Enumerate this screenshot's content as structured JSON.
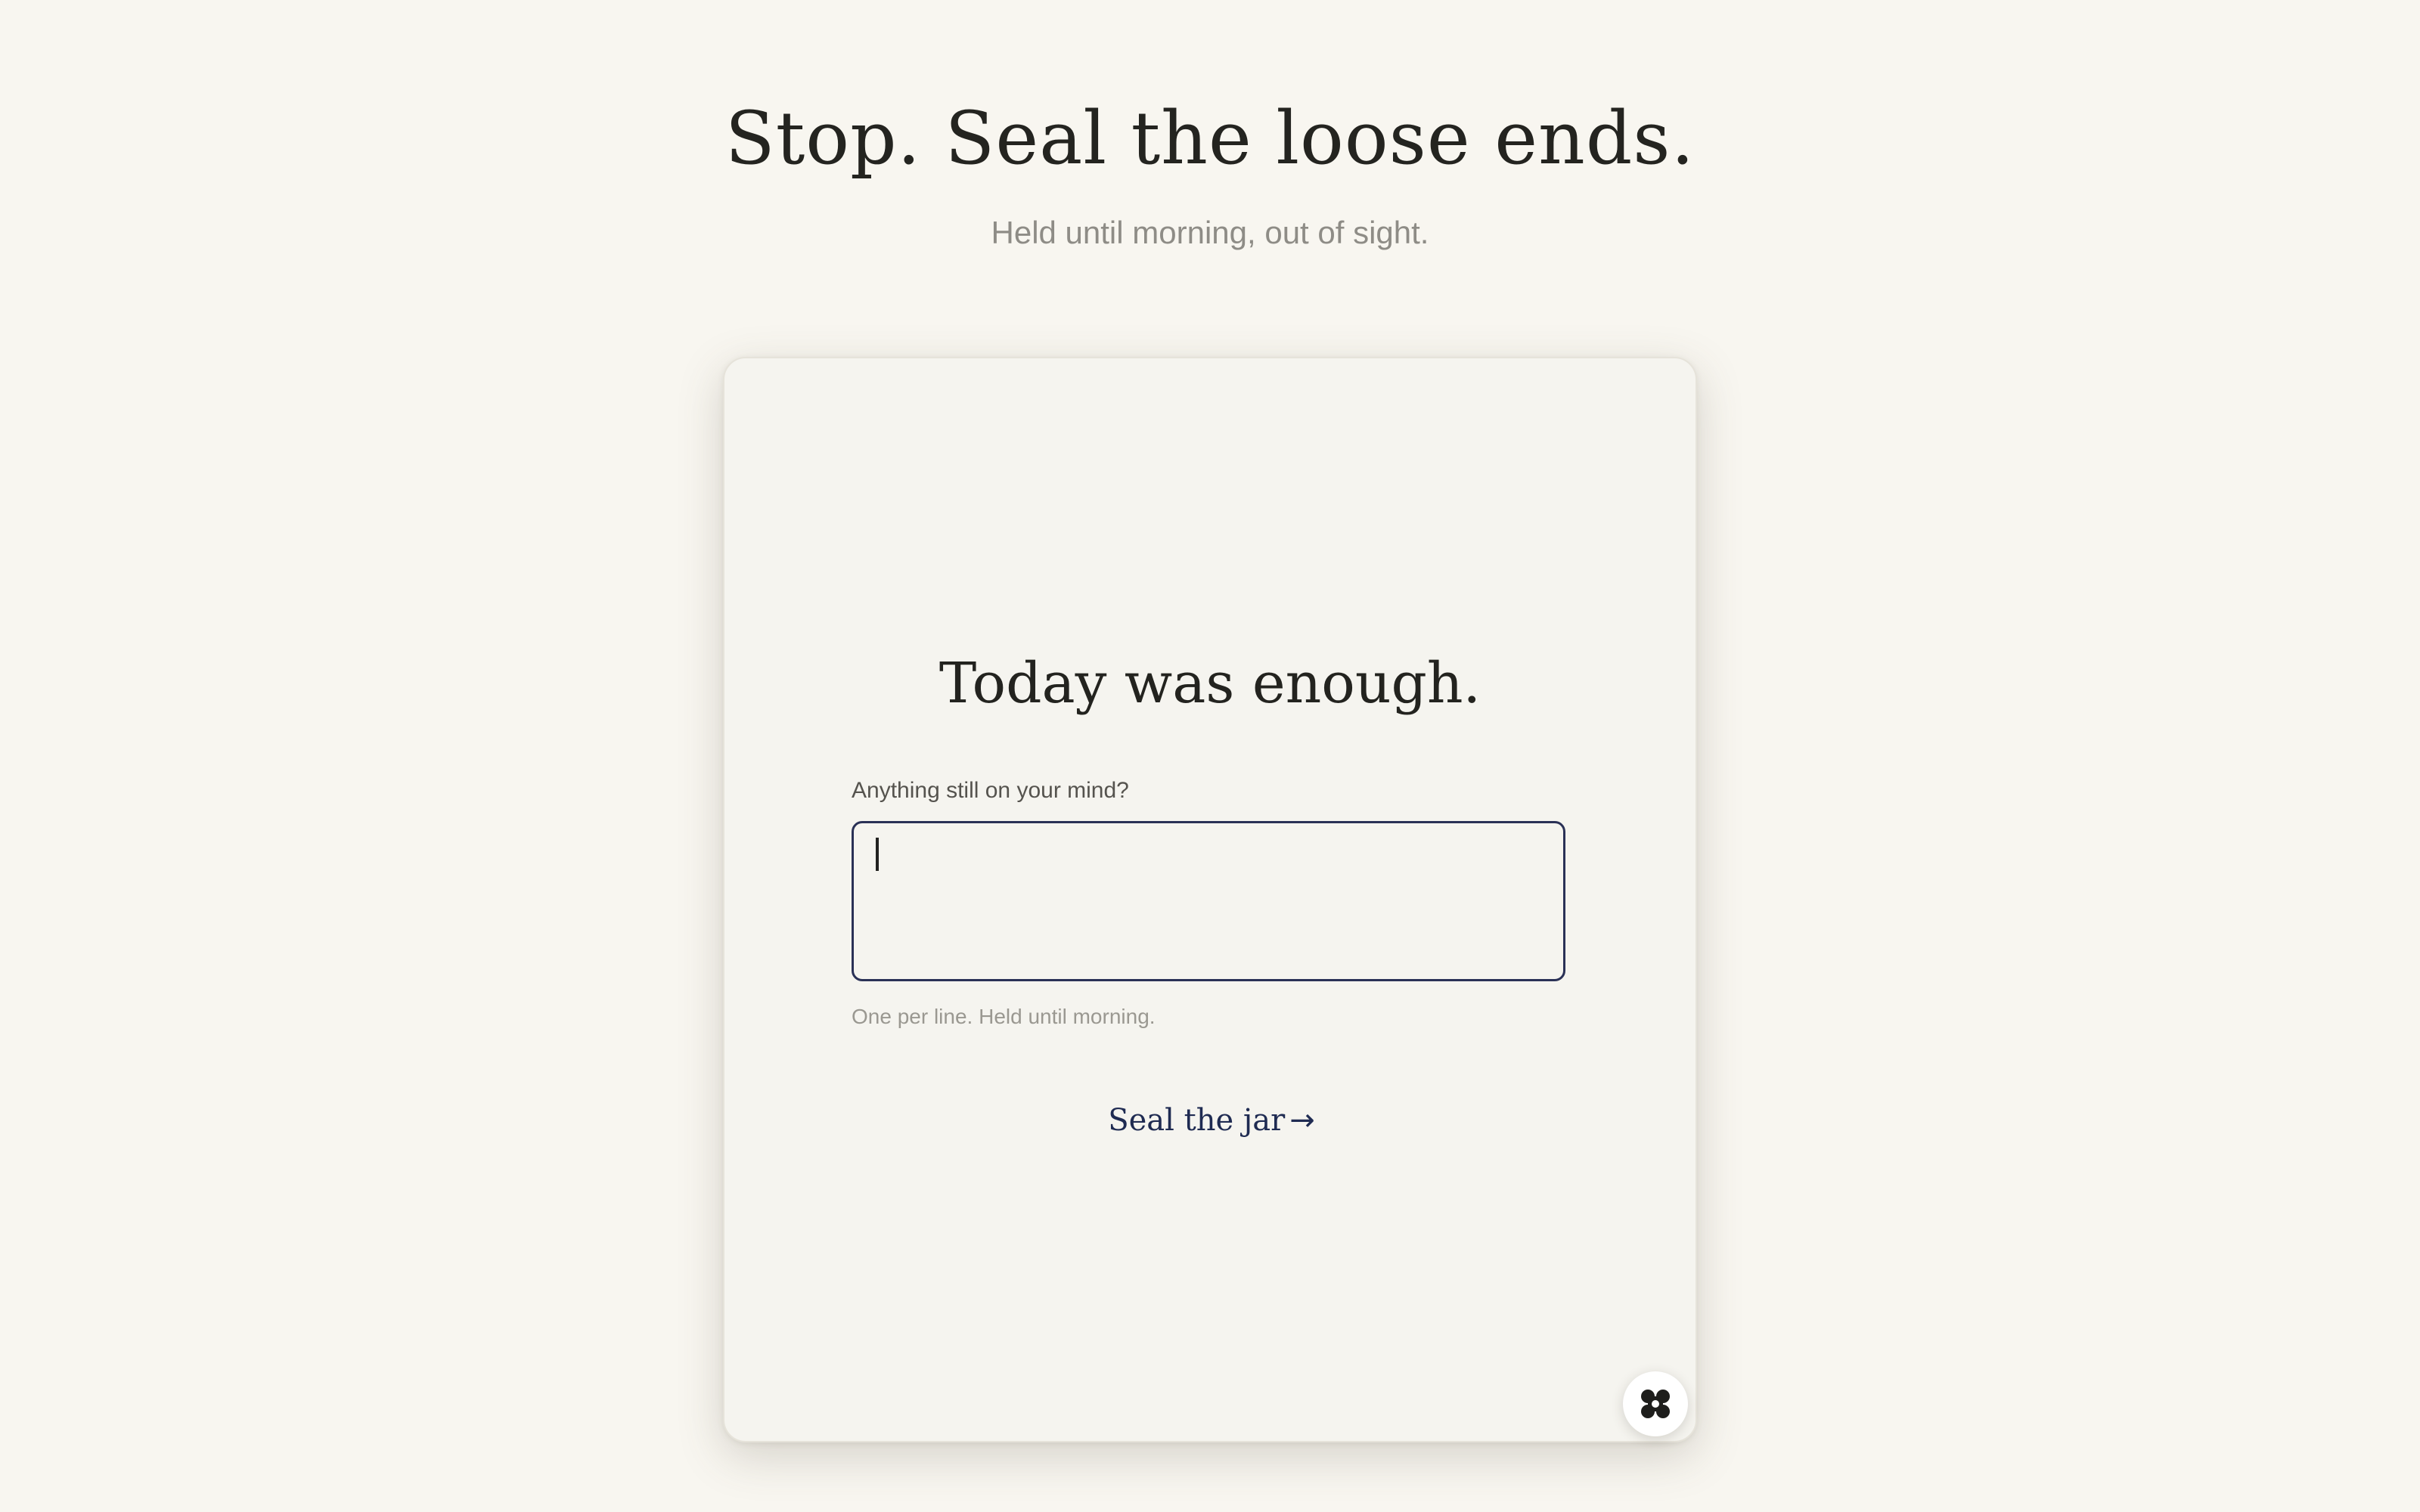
{
  "header": {
    "title": "Stop. Seal the loose ends.",
    "subtitle": "Held until morning, out of sight."
  },
  "card": {
    "heading": "Today was enough.",
    "field_label": "Anything still on your mind?",
    "input_value": "",
    "helper_text": "One per line. Held until morning.",
    "seal_button_label": "Seal the jar",
    "seal_button_arrow": "→"
  },
  "widget": {
    "icon": "four-petal-icon"
  },
  "colors": {
    "background": "#f8f6f0",
    "card": "#f5f4ef",
    "input_border": "#2a3156",
    "link": "#1f2b52"
  }
}
